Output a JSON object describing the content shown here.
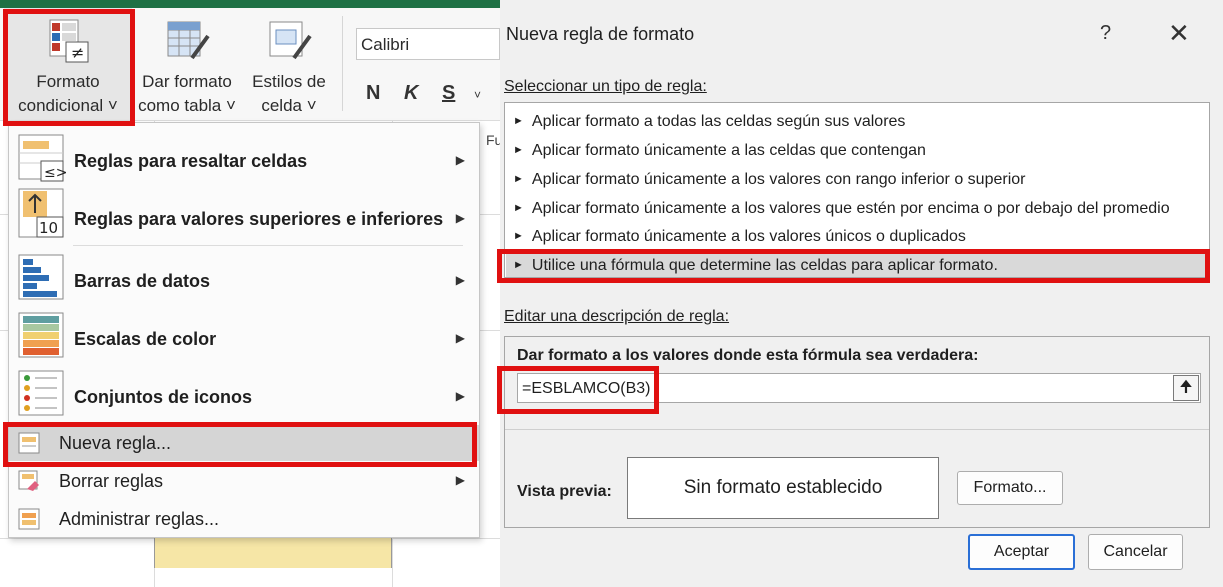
{
  "ribbon": {
    "conditional_format": {
      "line1": "Formato",
      "line2": "condicional ˅"
    },
    "format_as_table": {
      "line1": "Dar formato",
      "line2": "como tabla ˅"
    },
    "cell_styles": {
      "line1": "Estilos de",
      "line2": "celda ˅"
    },
    "font_name": "Calibri",
    "bold": "N",
    "italic": "K",
    "strike": "S",
    "more": "˅"
  },
  "sheet": {
    "partial_header": "Fu"
  },
  "dropdown": {
    "items": [
      {
        "label": "Reglas para resaltar celdas",
        "bold": true,
        "submenu": true
      },
      {
        "label": "Reglas para valores superiores e inferiores",
        "bold": true,
        "submenu": true
      },
      {
        "label": "Barras de datos",
        "bold": true,
        "submenu": true
      },
      {
        "label": "Escalas de color",
        "bold": true,
        "submenu": true
      },
      {
        "label": "Conjuntos de iconos",
        "bold": true,
        "submenu": true
      },
      {
        "label": "Nueva regla...",
        "bold": false,
        "submenu": false
      },
      {
        "label": "Borrar reglas",
        "bold": false,
        "submenu": true
      },
      {
        "label": "Administrar reglas...",
        "bold": false,
        "submenu": false
      }
    ],
    "arrow": "▶"
  },
  "dialog": {
    "title": "Nueva regla de formato",
    "help": "?",
    "close": "✕",
    "select_type_label": "Seleccionar un tipo de regla:",
    "rule_types": [
      "Aplicar formato a todas las celdas según sus valores",
      "Aplicar formato únicamente a las celdas que contengan",
      "Aplicar formato únicamente a los valores con rango inferior o superior",
      "Aplicar formato únicamente a los valores que estén por encima o por debajo del promedio",
      "Aplicar formato únicamente a los valores únicos o duplicados",
      "Utilice una fórmula que determine las celdas para aplicar formato."
    ],
    "rule_marker": "►",
    "edit_desc_label": "Editar una descripción de regla:",
    "formula_heading": "Dar formato a los valores donde esta fórmula sea verdadera:",
    "formula_value": "=ESBLAMCO(B3)",
    "collapse_icon": "🠉",
    "preview_label": "Vista previa:",
    "preview_text": "Sin formato establecido",
    "format_button": "Formato...",
    "ok_button": "Aceptar",
    "cancel_button": "Cancelar"
  },
  "colors": {
    "highlight": "#e01010",
    "excel_green": "#1f7145",
    "selected_row": "#d9d9d9"
  }
}
